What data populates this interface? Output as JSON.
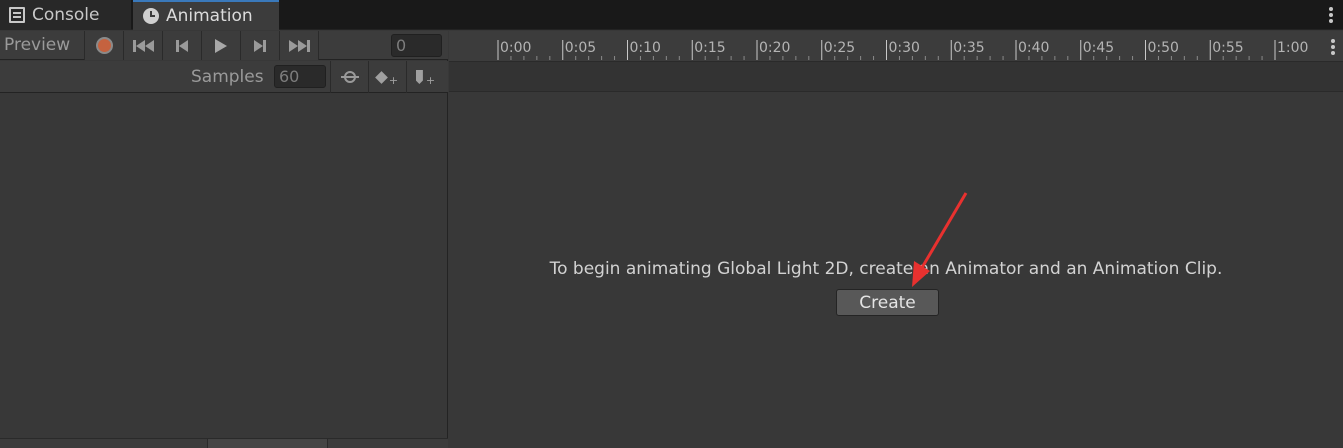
{
  "tabs": [
    {
      "label": "Console",
      "icon": "console-icon"
    },
    {
      "label": "Animation",
      "icon": "clock-icon",
      "active": true
    }
  ],
  "toolbar": {
    "preview_label": "Preview",
    "frame_value": "0",
    "samples_label": "Samples",
    "samples_value": "60"
  },
  "timeline": {
    "ticks": [
      "0:00",
      "0:05",
      "0:10",
      "0:15",
      "0:20",
      "0:25",
      "0:30",
      "0:35",
      "0:40",
      "0:45",
      "0:50",
      "0:55",
      "1:00"
    ]
  },
  "main": {
    "message": "To begin animating Global Light 2D, create an Animator and an Animation Clip.",
    "create_label": "Create"
  },
  "colors": {
    "record": "#c5623f",
    "active_tab_accent": "#3a79bb",
    "annotation_arrow": "#e8312f"
  }
}
